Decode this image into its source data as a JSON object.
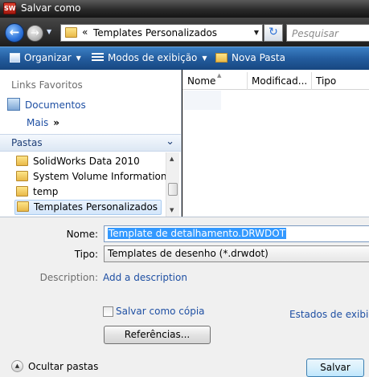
{
  "window": {
    "title": "Salvar como",
    "app_icon_text": "SW"
  },
  "nav": {
    "address_sep": "«",
    "address": "Templates Personalizados",
    "search_placeholder": "Pesquisar"
  },
  "toolbar": {
    "organize": "Organizar",
    "views": "Modos de exibição",
    "new_folder": "Nova Pasta"
  },
  "favorites": {
    "heading": "Links Favoritos",
    "items": [
      {
        "label": "Documentos"
      }
    ],
    "more": "Mais",
    "more_chevron": "»"
  },
  "folders": {
    "heading": "Pastas",
    "items": [
      {
        "label": "SolidWorks Data 2010",
        "selected": false
      },
      {
        "label": "System Volume Information",
        "selected": false
      },
      {
        "label": "temp",
        "selected": false
      },
      {
        "label": "Templates Personalizados",
        "selected": true
      }
    ]
  },
  "file_list": {
    "columns": [
      "Nome",
      "Modificad...",
      "Tipo"
    ]
  },
  "form": {
    "name_label": "Nome:",
    "name_value": "Template de detalhamento.DRWDOT",
    "type_label": "Tipo:",
    "type_value": "Templates de desenho (*.drwdot)",
    "description_label": "Description:",
    "description_link": "Add a description",
    "save_copy_label": "Salvar como cópia",
    "display_states": "Estados de exibição",
    "references_button": "Referências...",
    "hide_folders": "Ocultar pastas",
    "save_button": "Salvar"
  }
}
